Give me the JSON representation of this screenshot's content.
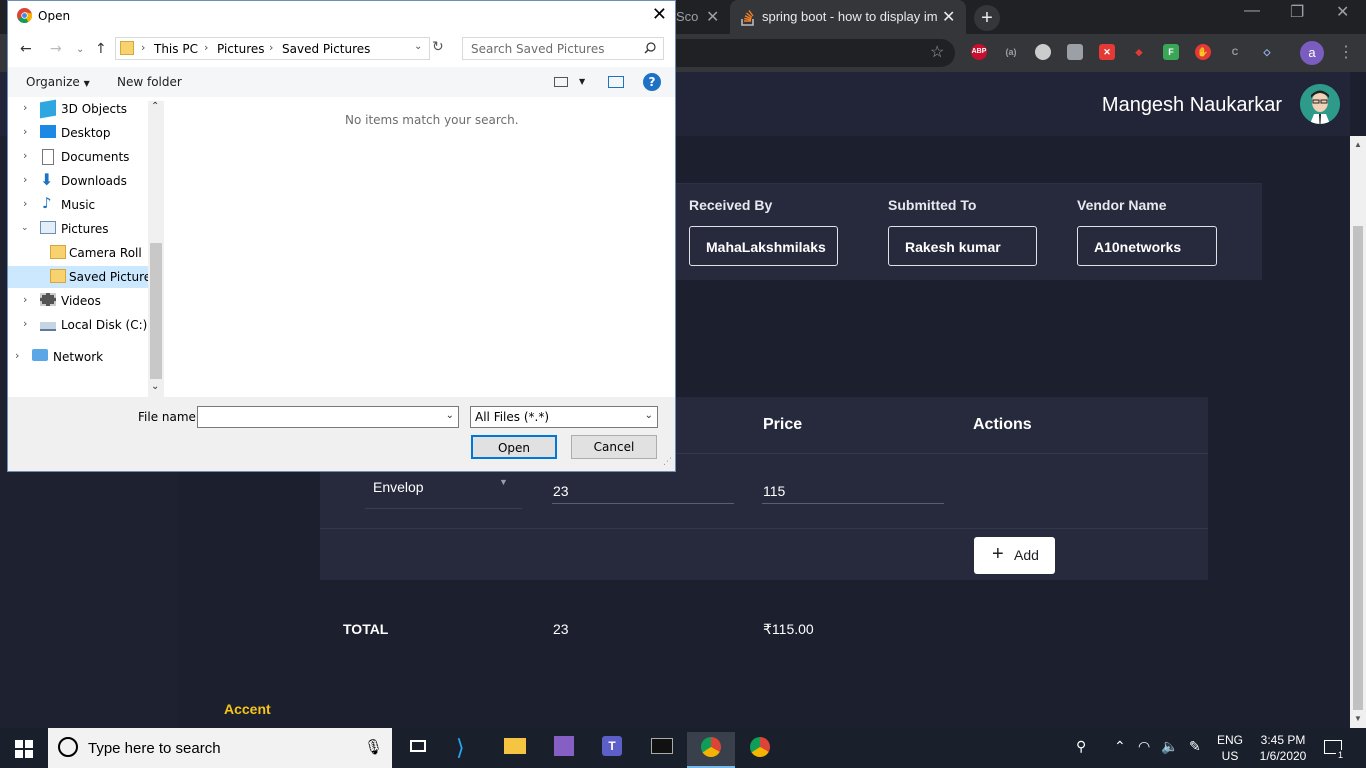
{
  "browser": {
    "tabs": [
      {
        "label": "Sco",
        "partial": true
      },
      {
        "label": "spring boot - how to display ima",
        "active": true
      }
    ],
    "new_tab_label": "+",
    "profile_initial": "a",
    "extensions": [
      "ABP",
      "(a)",
      "circle",
      "camera",
      "X",
      "shield",
      "F",
      "hand",
      "C",
      "diamond"
    ]
  },
  "app": {
    "user_name": "Mangesh Naukarkar",
    "fields": [
      {
        "label": "Received By",
        "value": "MahaLakshmilaks"
      },
      {
        "label": "Submitted To",
        "value": "Rakesh kumar"
      },
      {
        "label": "Vendor Name",
        "value": "A10networks"
      }
    ],
    "table": {
      "headers": {
        "price": "Price",
        "actions": "Actions"
      },
      "row": {
        "item": "Envelop",
        "quantity": "23",
        "price": "115"
      },
      "total": {
        "label": "TOTAL",
        "quantity": "23",
        "price": "₹115.00"
      },
      "add_button": "Add"
    },
    "accent_label": "Accent",
    "accent_color": "#f5c518"
  },
  "dialog": {
    "title": "Open",
    "path": [
      "This PC",
      "Pictures",
      "Saved Pictures"
    ],
    "search_placeholder": "Search Saved Pictures",
    "organize": "Organize",
    "new_folder": "New folder",
    "nav_items": [
      {
        "label": "3D Objects",
        "icon": "3d-objects-icon"
      },
      {
        "label": "Desktop",
        "icon": "desktop-icon"
      },
      {
        "label": "Documents",
        "icon": "documents-icon"
      },
      {
        "label": "Downloads",
        "icon": "downloads-icon"
      },
      {
        "label": "Music",
        "icon": "music-icon"
      },
      {
        "label": "Pictures",
        "icon": "pictures-icon",
        "expanded": true
      },
      {
        "label": "Camera Roll",
        "icon": "folder-icon",
        "child": true
      },
      {
        "label": "Saved Pictures",
        "icon": "folder-icon",
        "child": true,
        "selected": true
      },
      {
        "label": "Videos",
        "icon": "videos-icon"
      },
      {
        "label": "Local Disk (C:)",
        "icon": "disk-icon"
      },
      {
        "label": "Network",
        "icon": "network-icon"
      }
    ],
    "empty_message": "No items match your search.",
    "file_name_label": "File name:",
    "file_name_value": "",
    "filter_value": "All Files (*.*)",
    "open_button": "Open",
    "cancel_button": "Cancel"
  },
  "taskbar": {
    "search_placeholder": "Type here to search",
    "language": "ENG",
    "region": "US",
    "time": "3:45 PM",
    "date": "1/6/2020",
    "notification_count": "1"
  }
}
